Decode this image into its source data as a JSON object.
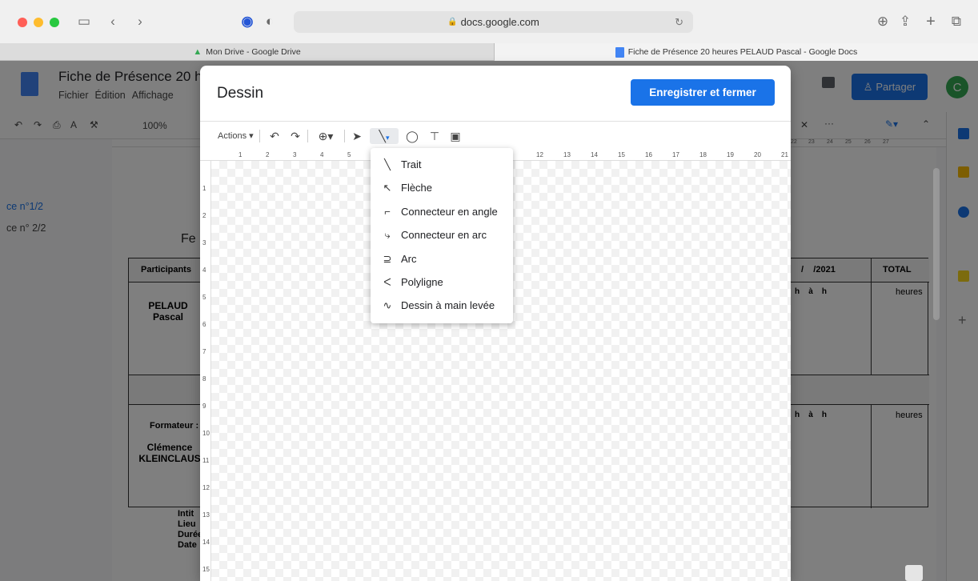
{
  "browser": {
    "url": "docs.google.com",
    "tabs": [
      {
        "label": "Mon Drive - Google Drive",
        "active": false
      },
      {
        "label": "Fiche de Présence 20 heures PELAUD Pascal - Google Docs",
        "active": true
      }
    ]
  },
  "doc": {
    "title": "Fiche de Présence 20 h",
    "menus": [
      "Fichier",
      "Édition",
      "Affichage"
    ],
    "zoom": "100%",
    "share_label": "Partager",
    "avatar_letter": "C",
    "outline": [
      "ce n°1/2",
      "ce n° 2/2"
    ],
    "heading_partial": "Fe",
    "table": {
      "participants_header": "Participants",
      "date_header": "/    /2021",
      "total_header": "TOTAL",
      "participant_name": "PELAUD Pascal",
      "hours_text": "h    à    h",
      "heures": "heures",
      "formateur_label": "Formateur :",
      "formateur_name": "Clémence KLEINCLAUS"
    },
    "footer_partial": [
      "Intit",
      "Lieu",
      "Durée",
      "Date"
    ],
    "ruler_right": [
      "22",
      "23",
      "24",
      "25",
      "26",
      "27"
    ]
  },
  "dialog": {
    "title": "Dessin",
    "save_label": "Enregistrer et fermer",
    "actions_label": "Actions",
    "ruler_numbers": [
      "1",
      "2",
      "3",
      "4",
      "5",
      "12",
      "13",
      "14",
      "15",
      "16",
      "17",
      "18",
      "19",
      "20",
      "21"
    ],
    "vruler_numbers": [
      "1",
      "2",
      "3",
      "4",
      "5",
      "6",
      "7",
      "8",
      "9",
      "10",
      "11",
      "12",
      "13",
      "14",
      "15"
    ]
  },
  "line_menu": {
    "items": [
      {
        "label": "Trait",
        "icon": "line-icon"
      },
      {
        "label": "Flèche",
        "icon": "arrow-icon"
      },
      {
        "label": "Connecteur en angle",
        "icon": "elbow-connector-icon"
      },
      {
        "label": "Connecteur en arc",
        "icon": "curved-connector-icon"
      },
      {
        "label": "Arc",
        "icon": "arc-icon"
      },
      {
        "label": "Polyligne",
        "icon": "polyline-icon"
      },
      {
        "label": "Dessin à main levée",
        "icon": "scribble-icon"
      }
    ]
  },
  "colors": {
    "accent": "#1a73e8",
    "docs_blue": "#4285f4"
  }
}
